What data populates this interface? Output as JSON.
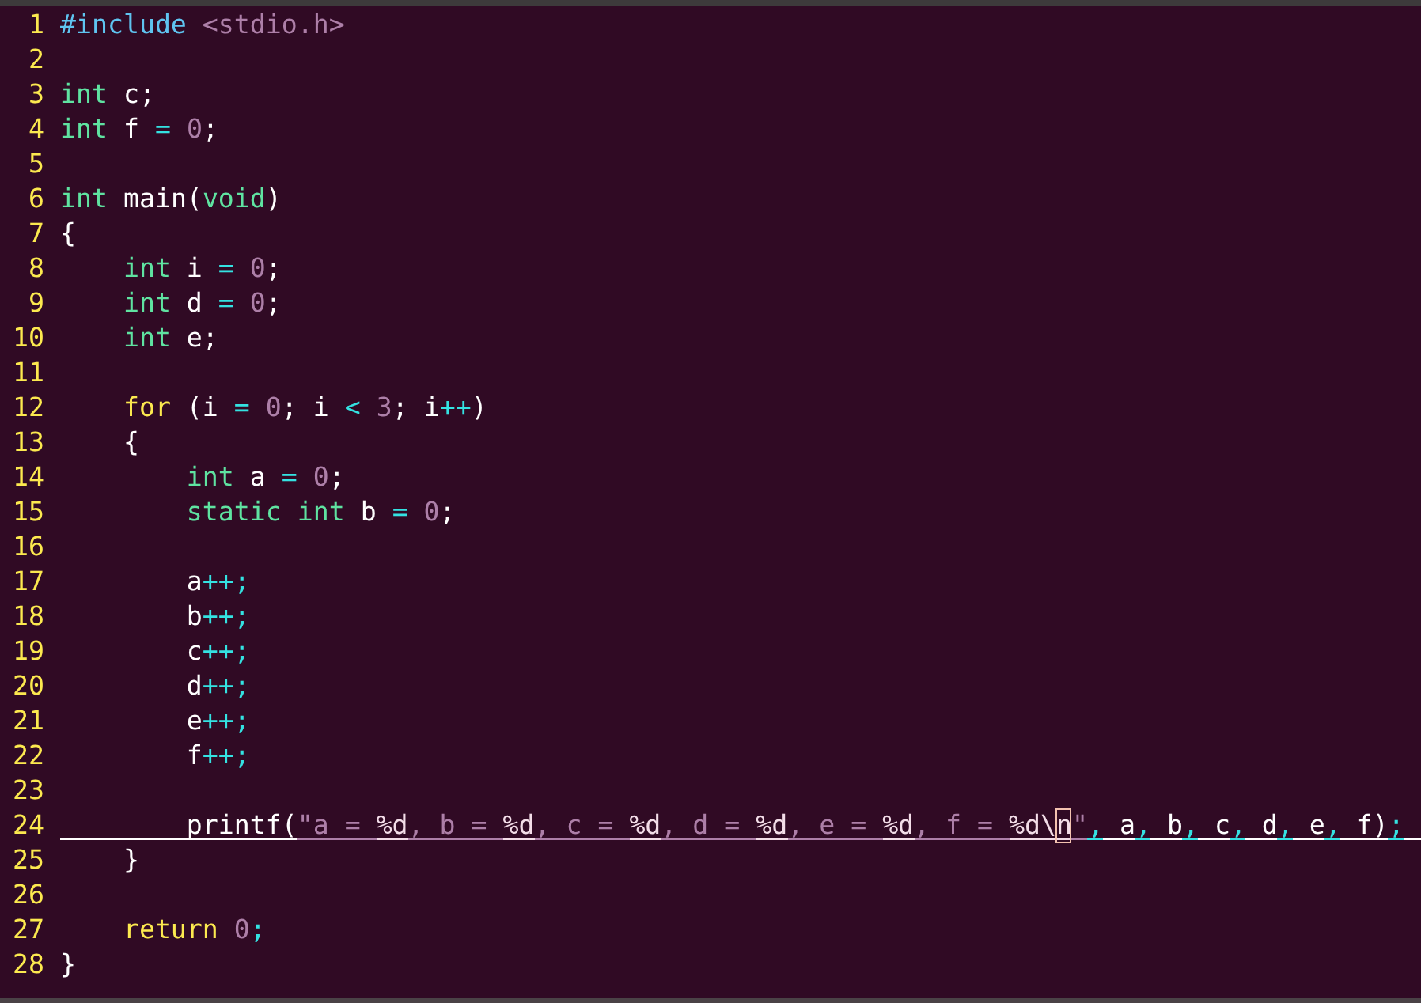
{
  "lines": [
    {
      "number": "1",
      "current": false,
      "tokens": [
        {
          "text": "#include ",
          "kind": "preproc"
        },
        {
          "text": "<stdio.h>",
          "kind": "string"
        }
      ]
    },
    {
      "number": "2",
      "current": false
    },
    {
      "number": "3",
      "current": false,
      "tokens": [
        {
          "text": "int",
          "kind": "type"
        },
        {
          "text": " c;",
          "kind": "plain"
        }
      ]
    },
    {
      "number": "4",
      "current": false,
      "tokens": [
        {
          "text": "int",
          "kind": "type"
        },
        {
          "text": " f ",
          "kind": "plain"
        },
        {
          "text": "= ",
          "kind": "op"
        },
        {
          "text": "0",
          "kind": "number"
        },
        {
          "text": ";",
          "kind": "plain"
        }
      ]
    },
    {
      "number": "5",
      "current": false
    },
    {
      "number": "6",
      "current": false,
      "tokens": [
        {
          "text": "int",
          "kind": "type"
        },
        {
          "text": " main(",
          "kind": "plain"
        },
        {
          "text": "void",
          "kind": "type"
        },
        {
          "text": ")",
          "kind": "plain"
        }
      ]
    },
    {
      "number": "7",
      "current": false,
      "tokens": [
        {
          "text": "{",
          "kind": "plain"
        }
      ]
    },
    {
      "number": "8",
      "current": false,
      "tokens": [
        {
          "text": "    int",
          "kind": "type"
        },
        {
          "text": " i ",
          "kind": "plain"
        },
        {
          "text": "= ",
          "kind": "op"
        },
        {
          "text": "0",
          "kind": "number"
        },
        {
          "text": ";",
          "kind": "plain"
        }
      ]
    },
    {
      "number": "9",
      "current": false,
      "tokens": [
        {
          "text": "    int",
          "kind": "type"
        },
        {
          "text": " d ",
          "kind": "plain"
        },
        {
          "text": "= ",
          "kind": "op"
        },
        {
          "text": "0",
          "kind": "number"
        },
        {
          "text": ";",
          "kind": "plain"
        }
      ]
    },
    {
      "number": "10",
      "current": false,
      "tokens": [
        {
          "text": "    int",
          "kind": "type"
        },
        {
          "text": " e;",
          "kind": "plain"
        }
      ]
    },
    {
      "number": "11",
      "current": false
    },
    {
      "number": "12",
      "current": false,
      "tokens": [
        {
          "text": "    for",
          "kind": "statement"
        },
        {
          "text": " (i ",
          "kind": "plain"
        },
        {
          "text": "= ",
          "kind": "op"
        },
        {
          "text": "0",
          "kind": "number"
        },
        {
          "text": "; i ",
          "kind": "plain"
        },
        {
          "text": "< ",
          "kind": "op"
        },
        {
          "text": "3",
          "kind": "number"
        },
        {
          "text": "; i",
          "kind": "plain"
        },
        {
          "text": "++",
          "kind": "op"
        },
        {
          "text": ")",
          "kind": "plain"
        }
      ]
    },
    {
      "number": "13",
      "current": false,
      "tokens": [
        {
          "text": "    {",
          "kind": "plain"
        }
      ]
    },
    {
      "number": "14",
      "current": false,
      "tokens": [
        {
          "text": "        int",
          "kind": "type"
        },
        {
          "text": " a ",
          "kind": "plain"
        },
        {
          "text": "= ",
          "kind": "op"
        },
        {
          "text": "0",
          "kind": "number"
        },
        {
          "text": ";",
          "kind": "plain"
        }
      ]
    },
    {
      "number": "15",
      "current": false,
      "tokens": [
        {
          "text": "        static int",
          "kind": "type"
        },
        {
          "text": " b ",
          "kind": "plain"
        },
        {
          "text": "= ",
          "kind": "op"
        },
        {
          "text": "0",
          "kind": "number"
        },
        {
          "text": ";",
          "kind": "plain"
        }
      ]
    },
    {
      "number": "16",
      "current": false
    },
    {
      "number": "17",
      "current": false,
      "tokens": [
        {
          "text": "        a",
          "kind": "plain"
        },
        {
          "text": "++;",
          "kind": "op"
        }
      ]
    },
    {
      "number": "18",
      "current": false,
      "tokens": [
        {
          "text": "        b",
          "kind": "plain"
        },
        {
          "text": "++;",
          "kind": "op"
        }
      ]
    },
    {
      "number": "19",
      "current": false,
      "tokens": [
        {
          "text": "        c",
          "kind": "plain"
        },
        {
          "text": "++;",
          "kind": "op"
        }
      ]
    },
    {
      "number": "20",
      "current": false,
      "tokens": [
        {
          "text": "        d",
          "kind": "plain"
        },
        {
          "text": "++;",
          "kind": "op"
        }
      ]
    },
    {
      "number": "21",
      "current": false,
      "tokens": [
        {
          "text": "        e",
          "kind": "plain"
        },
        {
          "text": "++;",
          "kind": "op"
        }
      ]
    },
    {
      "number": "22",
      "current": false,
      "tokens": [
        {
          "text": "        f",
          "kind": "plain"
        },
        {
          "text": "++;",
          "kind": "op"
        }
      ]
    },
    {
      "number": "23",
      "current": false
    },
    {
      "number": "24",
      "current": true,
      "tokens": [
        {
          "text": "        printf(",
          "kind": "plain"
        },
        {
          "text": "\"a = ",
          "kind": "string"
        },
        {
          "text": "%d",
          "kind": "special"
        },
        {
          "text": ", b = ",
          "kind": "string"
        },
        {
          "text": "%d",
          "kind": "special"
        },
        {
          "text": ", c = ",
          "kind": "string"
        },
        {
          "text": "%d",
          "kind": "special"
        },
        {
          "text": ", d = ",
          "kind": "string"
        },
        {
          "text": "%d",
          "kind": "special"
        },
        {
          "text": ", e = ",
          "kind": "string"
        },
        {
          "text": "%d",
          "kind": "special"
        },
        {
          "text": ", f = ",
          "kind": "string"
        },
        {
          "text": "%d\\",
          "kind": "special"
        },
        {
          "text": "n",
          "kind": "cursor"
        },
        {
          "text": "\"",
          "kind": "string"
        },
        {
          "text": ",",
          "kind": "op"
        },
        {
          "text": " a",
          "kind": "plain"
        },
        {
          "text": ",",
          "kind": "op"
        },
        {
          "text": " b",
          "kind": "plain"
        },
        {
          "text": ",",
          "kind": "op"
        },
        {
          "text": " c",
          "kind": "plain"
        },
        {
          "text": ",",
          "kind": "op"
        },
        {
          "text": " d",
          "kind": "plain"
        },
        {
          "text": ",",
          "kind": "op"
        },
        {
          "text": " e",
          "kind": "plain"
        },
        {
          "text": ",",
          "kind": "op"
        },
        {
          "text": " f)",
          "kind": "plain"
        },
        {
          "text": ";",
          "kind": "op"
        }
      ]
    },
    {
      "number": "25",
      "current": false,
      "tokens": [
        {
          "text": "    }",
          "kind": "plain"
        }
      ]
    },
    {
      "number": "26",
      "current": false
    },
    {
      "number": "27",
      "current": false,
      "tokens": [
        {
          "text": "    return ",
          "kind": "statement"
        },
        {
          "text": "0",
          "kind": "number"
        },
        {
          "text": ";",
          "kind": "op"
        }
      ]
    },
    {
      "number": "28",
      "current": false,
      "tokens": [
        {
          "text": "}",
          "kind": "plain"
        }
      ]
    }
  ]
}
